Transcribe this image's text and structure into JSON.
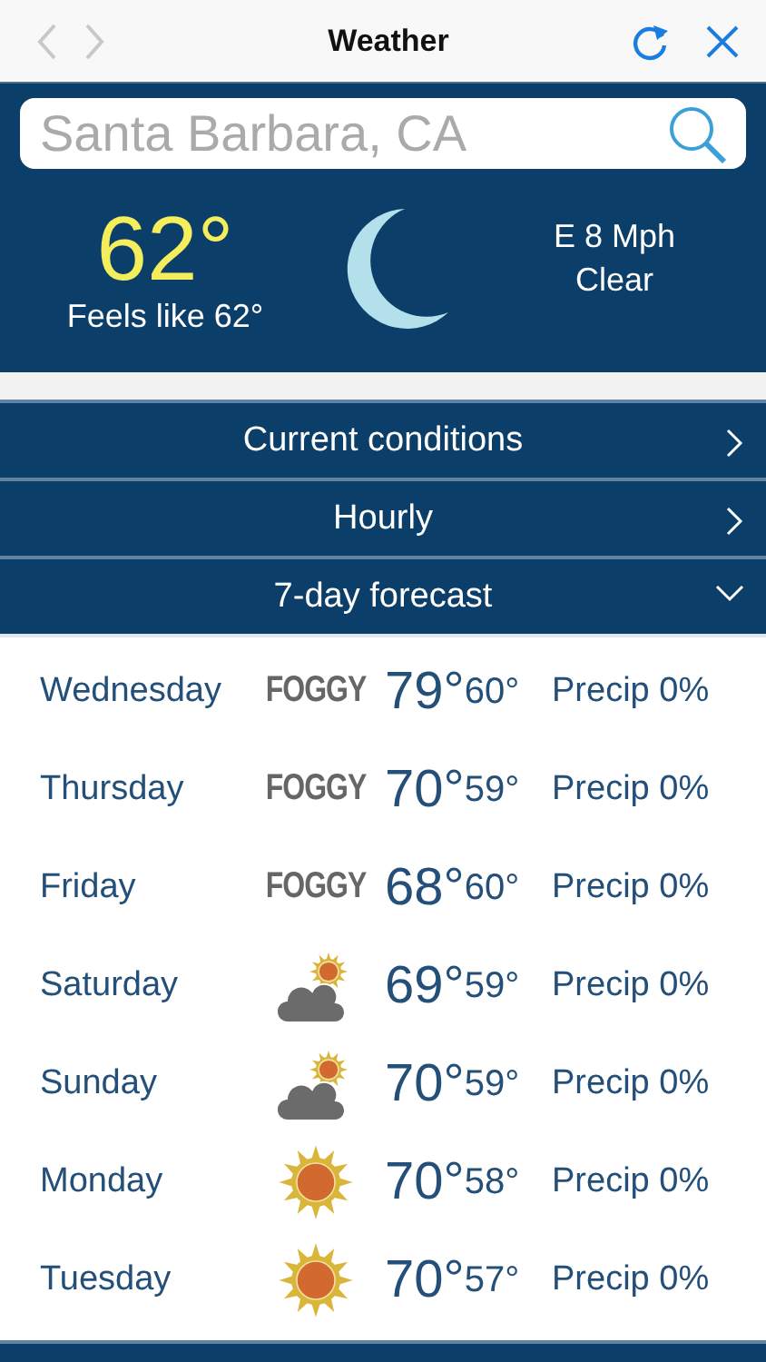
{
  "top_bar": {
    "title": "Weather"
  },
  "search": {
    "value": "Santa Barbara, CA"
  },
  "current": {
    "temperature": "62°",
    "feels_like": "Feels like 62°",
    "wind": "E 8 Mph",
    "condition": "Clear"
  },
  "sections": [
    {
      "label": "Current conditions",
      "expanded": false
    },
    {
      "label": "Hourly",
      "expanded": false
    },
    {
      "label": "7-day forecast",
      "expanded": true
    }
  ],
  "forecast": [
    {
      "day": "Wednesday",
      "kind": "foggy",
      "condition_text": "FOGGY",
      "high": "79°",
      "low": "60°",
      "precip": "Precip 0%"
    },
    {
      "day": "Thursday",
      "kind": "foggy",
      "condition_text": "FOGGY",
      "high": "70°",
      "low": "59°",
      "precip": "Precip 0%"
    },
    {
      "day": "Friday",
      "kind": "foggy",
      "condition_text": "FOGGY",
      "high": "68°",
      "low": "60°",
      "precip": "Precip 0%"
    },
    {
      "day": "Saturday",
      "kind": "partly-cloudy",
      "high": "69°",
      "low": "59°",
      "precip": "Precip 0%"
    },
    {
      "day": "Sunday",
      "kind": "partly-cloudy",
      "high": "70°",
      "low": "59°",
      "precip": "Precip 0%"
    },
    {
      "day": "Monday",
      "kind": "sunny",
      "high": "70°",
      "low": "58°",
      "precip": "Precip 0%"
    },
    {
      "day": "Tuesday",
      "kind": "sunny",
      "high": "70°",
      "low": "57°",
      "precip": "Precip 0%"
    }
  ]
}
